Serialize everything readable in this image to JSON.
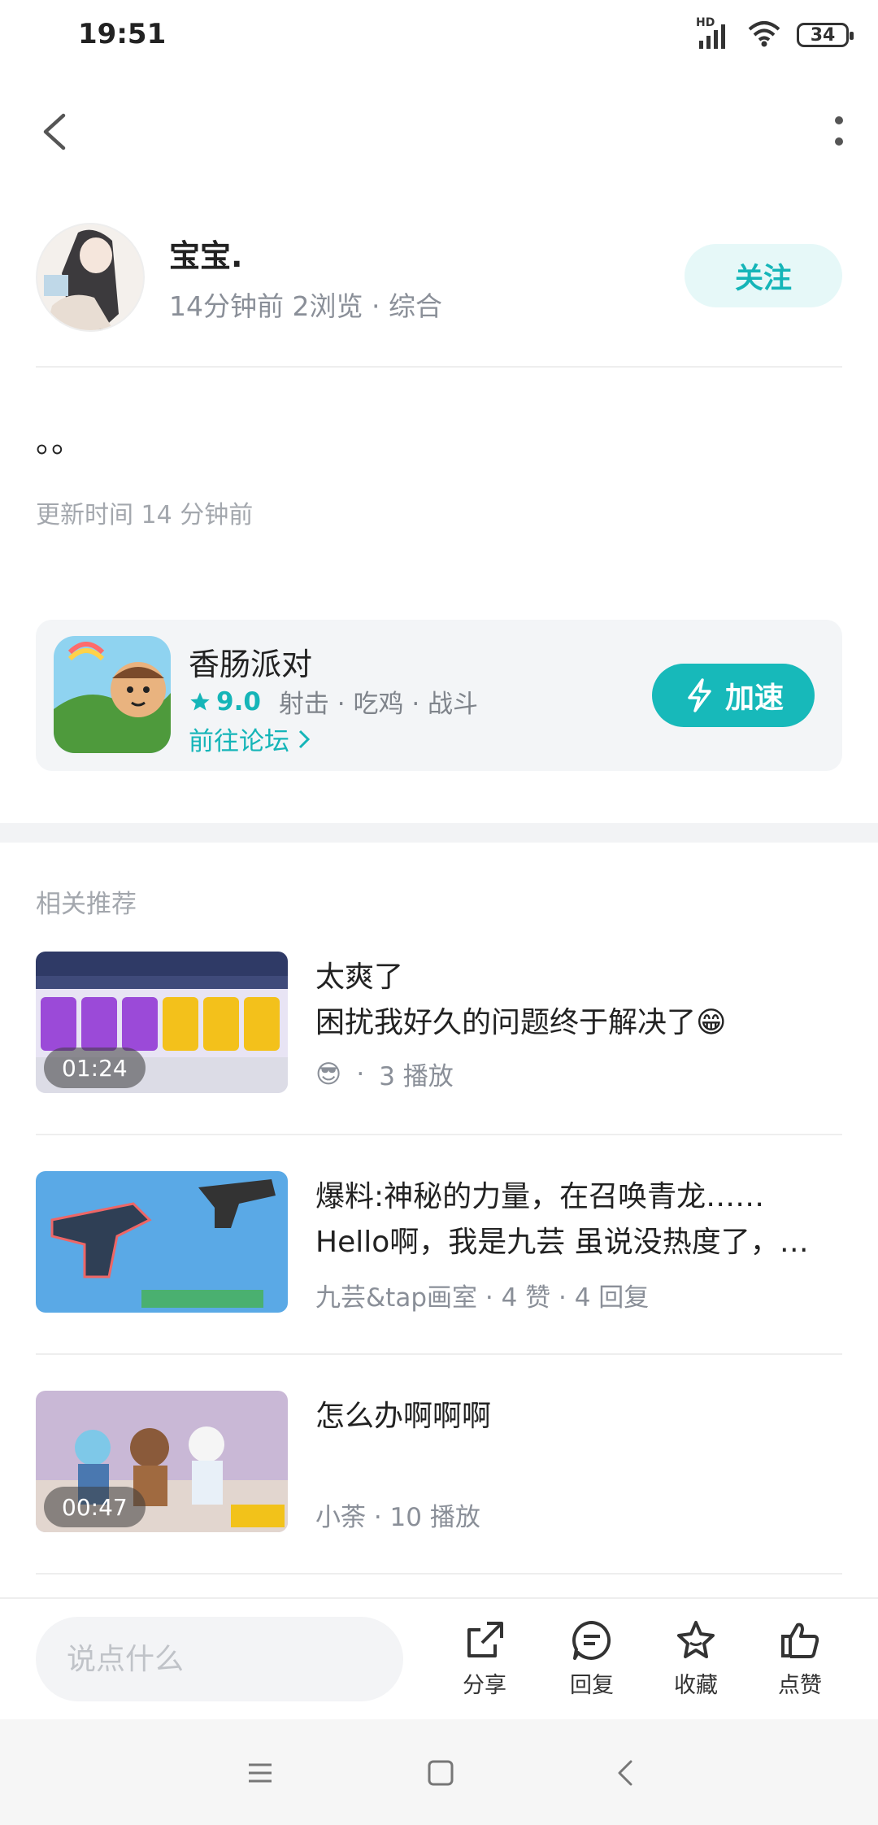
{
  "status_bar": {
    "time": "19:51",
    "network": "HD",
    "battery": "34"
  },
  "icons": {
    "back": "back-arrow-icon",
    "more": "more-vertical-icon",
    "share": "share-icon",
    "reply": "comment-icon",
    "favorite": "star-icon",
    "like": "thumb-up-icon"
  },
  "author": {
    "name": "宝宝.",
    "meta": "14分钟前 2浏览 · 综合",
    "follow_label": "关注"
  },
  "post": {
    "body": "。。",
    "update_time": "更新时间 14 分钟前"
  },
  "game": {
    "name": "香肠派对",
    "rating": "9.0",
    "tags": "射击 · 吃鸡 · 战斗",
    "forum_link": "前往论坛",
    "speed_label": "加速"
  },
  "recommend": {
    "title": "相关推荐",
    "items": [
      {
        "title": "太爽了",
        "line2": "困扰我好久的问题终于解决了😁",
        "emoji": "😎",
        "meta": "3 播放",
        "duration": "01:24"
      },
      {
        "title": "爆料:神秘的力量，在召唤青龙……",
        "line2": "Hello啊，我是九芸 虽说没热度了，…",
        "meta": "九芸&tap画室 · 4 赞 · 4 回复"
      },
      {
        "title": "怎么办啊啊啊",
        "meta": "小荼 · 10 播放",
        "duration": "00:47"
      }
    ]
  },
  "actions": {
    "placeholder": "说点什么",
    "share": "分享",
    "reply": "回复",
    "favorite": "收藏",
    "like": "点赞"
  },
  "colors": {
    "accent": "#15b5b8",
    "follow_bg": "#e6f8f8"
  }
}
